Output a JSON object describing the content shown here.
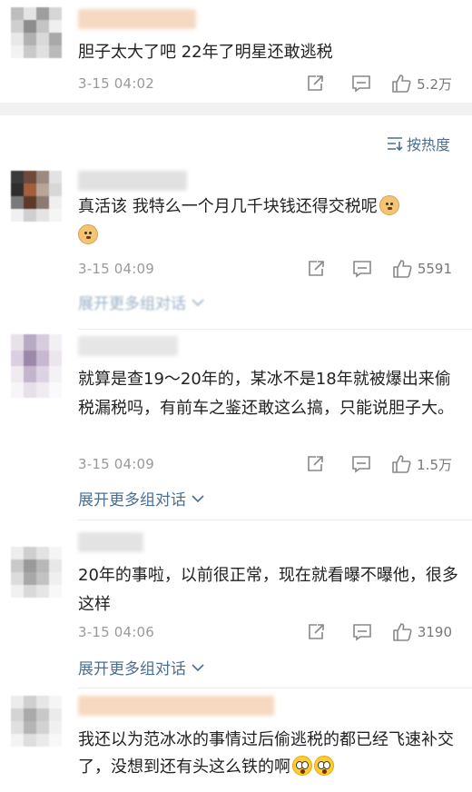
{
  "sort_label": "按热度",
  "expand_label": "展开更多组对话",
  "comments": [
    {
      "text": "胆子太大了吧 22年了明星还敢逃税",
      "time": "3-15 04:02",
      "likes": "5.2万",
      "avatar": [
        "#bdbdbd",
        "#e4e4e4",
        "#9e9e9e",
        "#d6d6d6",
        "#cfcfcf",
        "#8d8d8d",
        "#c4c4c4",
        "#efefef",
        "#e8e8e8",
        "#b1b1b1",
        "#d9d9d9",
        "#a9a9a9",
        "#f2f2f2",
        "#c9c9c9",
        "#e0e0e0",
        "#bababa"
      ],
      "name_color": "#f6d9c3"
    },
    {
      "text": "真活该  我特么一个月几千块钱还得交税呢",
      "time": "3-15 04:09",
      "likes": "5591",
      "avatar": [
        "#3b3b3b",
        "#6d4a3a",
        "#9a8a80",
        "#e2e2e2",
        "#2e2e2e",
        "#a0603f",
        "#b8a595",
        "#d8d8d8",
        "#7a7a7a",
        "#5c3a2a",
        "#8c7b70",
        "#efefef",
        "#f0f0f0",
        "#cfcfcf",
        "#e4e4e4",
        "#f5f5f5"
      ],
      "name_color": "#e1e1e1"
    },
    {
      "text": "就算是查19～20年的，某冰不是18年就被爆出来偷税漏税吗，有前车之鉴还敢这么搞，只能说胆子大。",
      "time": "3-15 04:09",
      "likes": "1.5万",
      "avatar": [
        "#e7e2ea",
        "#b9aac3",
        "#d6ccde",
        "#f3f0f5",
        "#d9cfe0",
        "#9c88a8",
        "#c7b7d1",
        "#ebe6ee",
        "#efebf1",
        "#c4b5cc",
        "#ddd4e3",
        "#f5f2f6",
        "#f7f5f8",
        "#e6e0e9",
        "#f0ecf2",
        "#faf9fb"
      ],
      "name_color": "#e6e6e6"
    },
    {
      "text": "20年的事啦，以前很正常，现在就看曝不曝他，很多这样",
      "time": "3-15 04:06",
      "likes": "3190",
      "avatar": [
        "#ededed",
        "#cfcfcf",
        "#e3e3e3",
        "#f5f5f5",
        "#c9c9c9",
        "#9a9a9a",
        "#b8b8b8",
        "#e8e8e8",
        "#dcdcdc",
        "#a8a8a8",
        "#c2c2c2",
        "#efefef",
        "#f1f1f1",
        "#d9d9d9",
        "#e6e6e6",
        "#f8f8f8"
      ],
      "name_color": "#e3e3e3"
    },
    {
      "text": "我还以为范冰冰的事情过后偷逃税的都已经飞速补交了，没想到还有头这么铁的啊",
      "time": "",
      "likes": "",
      "avatar": [
        "#ececec",
        "#cfcfcf",
        "#e6e6e6",
        "#f5f5f5",
        "#d4d4d4",
        "#aaaaaa",
        "#c8c8c8",
        "#ebebeb",
        "#e0e0e0",
        "#b5b5b5",
        "#d2d2d2",
        "#f0f0f0",
        "#f3f3f3",
        "#dedede",
        "#eaeaea",
        "#f8f8f8"
      ],
      "name_color": "#f7d9bf"
    }
  ]
}
